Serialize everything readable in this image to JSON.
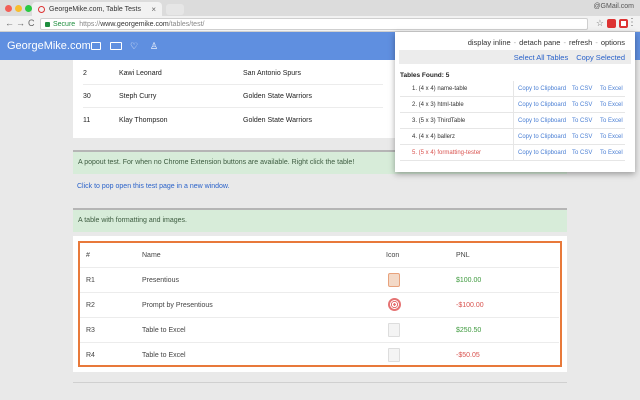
{
  "browser": {
    "tab_title": "GeorgeMike.com, Table Tests",
    "tab_close": "×",
    "user": "@GMail.com",
    "secure_label": "Secure",
    "url_prefix": "https://",
    "url_domain": "www.georgemike.com",
    "url_path": "/tables/test/",
    "back": "←",
    "forward": "→",
    "reload": "C",
    "star": "☆",
    "menu": "⋮"
  },
  "site": {
    "brand": "GeorgeMike.com",
    "heart": "♡",
    "person": "♙",
    "brand_color": "#5f8fe0"
  },
  "players": [
    {
      "num": "2",
      "name": "Kawi Leonard",
      "team": "San Antonio Spurs"
    },
    {
      "num": "30",
      "name": "Steph Curry",
      "team": "Golden State Warriors"
    },
    {
      "num": "11",
      "name": "Klay Thompson",
      "team": "Golden State Warriors"
    }
  ],
  "popout_alert": "A popout test. For when no Chrome Extension buttons are available. Right click the table!",
  "popout_link": "Click to pop open this test page in a new window.",
  "format_alert": "A table with formatting and images.",
  "fmt_table": {
    "headers": {
      "id": "#",
      "name": "Name",
      "icon": "Icon",
      "pnl": "PNL"
    },
    "rows": [
      {
        "id": "R1",
        "name": "Presentious",
        "icon": "presentious-icon",
        "pnl": "$100.00",
        "tone": "pos"
      },
      {
        "id": "R2",
        "name": "Prompt by Presentious",
        "icon": "prompt-icon",
        "pnl": "-$100.00",
        "tone": "neg"
      },
      {
        "id": "R3",
        "name": "Table to Excel",
        "icon": "excel-icon",
        "pnl": "$250.50",
        "tone": "pos"
      },
      {
        "id": "R4",
        "name": "Table to Excel",
        "icon": "excel-icon",
        "pnl": "-$50.05",
        "tone": "neg"
      }
    ]
  },
  "popup": {
    "nav": {
      "inline": "display inline",
      "detach": "detach pane",
      "refresh": "refresh",
      "options": "options",
      "sep": "-"
    },
    "select_all": "Select All Tables",
    "copy_selected": "Copy Selected",
    "tables_found": "Tables Found: 5",
    "tables": [
      {
        "label": "1. (4 x 4) name-table",
        "highlight": false
      },
      {
        "label": "2. (4 x 3) html-table",
        "highlight": false
      },
      {
        "label": "3. (5 x 3) ThirdTable",
        "highlight": false
      },
      {
        "label": "4. (4 x 4) ballerz",
        "highlight": false
      },
      {
        "label": "5. (5 x 4) formatting-tester",
        "highlight": true
      }
    ],
    "copy_label": "Copy to Clipboard",
    "csv_label": "To CSV",
    "excel_label": "To Excel"
  }
}
